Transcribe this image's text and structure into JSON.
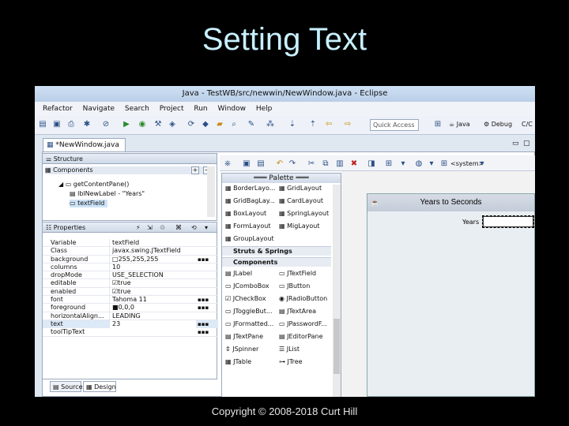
{
  "slide": {
    "title": "Setting Text",
    "footer": "Copyright © 2008-2018 Curt Hill"
  },
  "window": {
    "title": "Java - TestWB/src/newwin/NewWindow.java - Eclipse",
    "menu": [
      "Refactor",
      "Navigate",
      "Search",
      "Project",
      "Run",
      "Window",
      "Help"
    ],
    "quick_access": "Quick Access",
    "perspectives": [
      "Java",
      "Debug",
      "C/C"
    ],
    "editor_tab": "*NewWindow.java"
  },
  "structure": {
    "header": "Structure",
    "components_label": "Components",
    "tree": [
      "getContentPane()",
      "lblNewLabel - \"Years\"",
      "textField"
    ]
  },
  "properties": {
    "header": "Properties",
    "rows": [
      {
        "key": "Variable",
        "value": "textField"
      },
      {
        "key": "Class",
        "value": "javax.swing.JTextField"
      },
      {
        "key": "background",
        "value": "255,255,255"
      },
      {
        "key": "columns",
        "value": "10"
      },
      {
        "key": "dropMode",
        "value": "USE_SELECTION"
      },
      {
        "key": "editable",
        "value": "true"
      },
      {
        "key": "enabled",
        "value": "true"
      },
      {
        "key": "font",
        "value": "Tahoma 11"
      },
      {
        "key": "foreground",
        "value": "0,0,0"
      },
      {
        "key": "horizontalAlign...",
        "value": "LEADING"
      },
      {
        "key": "text",
        "value": "23"
      },
      {
        "key": "toolTipText",
        "value": ""
      }
    ]
  },
  "palette": {
    "header": "Palette",
    "layouts": [
      "BorderLayo...",
      "GridLayout",
      "GridBagLay...",
      "CardLayout",
      "BoxLayout",
      "SpringLayout",
      "FormLayout",
      "MigLayout",
      "GroupLayout"
    ],
    "cat_struts": "Struts & Springs",
    "cat_components": "Components",
    "components": [
      "JLabel",
      "JTextField",
      "JComboBox",
      "JButton",
      "JCheckBox",
      "JRadioButton",
      "JToggleBut...",
      "JTextArea",
      "JFormatted...",
      "JPasswordF...",
      "JTextPane",
      "JEditorPane",
      "JSpinner",
      "JList",
      "JTable",
      "JTree"
    ]
  },
  "design": {
    "system_combo": "<system>",
    "frame_title": "Years to Seconds",
    "label": "Years"
  },
  "bottom_tabs": [
    "Source",
    "Design"
  ]
}
